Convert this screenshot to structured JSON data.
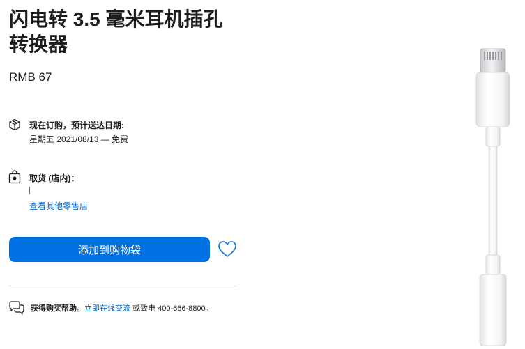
{
  "product": {
    "title": "闪电转 3.5 毫米耳机插孔转换器",
    "price": "RMB 67"
  },
  "delivery": {
    "icon": "box-icon",
    "title": "现在订购，预计送达日期:",
    "detail": "星期五 2021/08/13 — 免费"
  },
  "pickup": {
    "icon": "shopping-bag-icon",
    "title": "取货 (店内)：",
    "other_stores_link": "查看其他零售店"
  },
  "actions": {
    "add_to_bag_label": "添加到购物袋",
    "favorite_icon": "heart-icon"
  },
  "help": {
    "icon": "chat-bubbles-icon",
    "prefix": "获得购买帮助。",
    "chat_link": "立即在线交流",
    "suffix": " 或致电 400-666-8800。"
  },
  "colors": {
    "primary_button": "#0071e3",
    "link": "#0066cc",
    "text": "#1d1d1f",
    "divider": "#d2d2d7"
  }
}
